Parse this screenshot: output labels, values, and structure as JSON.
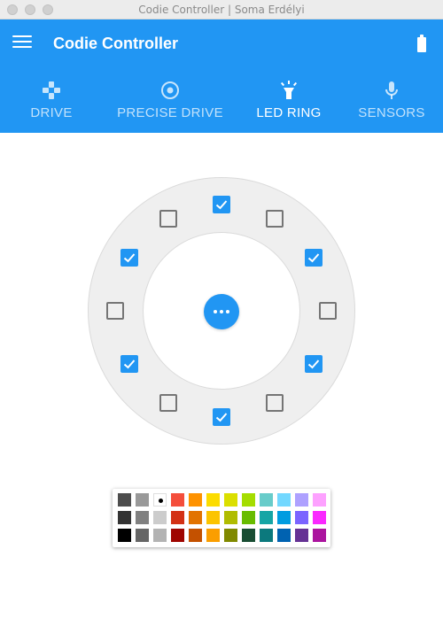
{
  "window": {
    "title": "Codie Controller | Soma Erdélyi"
  },
  "appbar": {
    "title": "Codie Controller",
    "accent_color": "#2196f3",
    "menu_icon": "menu-icon",
    "battery_icon": "battery-full-icon"
  },
  "tabs": [
    {
      "label": "DRIVE",
      "icon": "gamepad-icon",
      "active": false
    },
    {
      "label": "PRECISE DRIVE",
      "icon": "target-icon",
      "active": false
    },
    {
      "label": "LED RING",
      "icon": "light-icon",
      "active": true
    },
    {
      "label": "SENSORS",
      "icon": "microphone-icon",
      "active": false
    }
  ],
  "led_ring": {
    "leds": [
      {
        "position": "12 o'clock",
        "checked": true
      },
      {
        "position": "1 o'clock",
        "checked": false
      },
      {
        "position": "2 o'clock",
        "checked": true
      },
      {
        "position": "3 o'clock",
        "checked": false
      },
      {
        "position": "4 o'clock",
        "checked": true
      },
      {
        "position": "5 o'clock",
        "checked": false
      },
      {
        "position": "6 o'clock",
        "checked": true
      },
      {
        "position": "7 o'clock",
        "checked": false
      },
      {
        "position": "8 o'clock",
        "checked": true
      },
      {
        "position": "9 o'clock",
        "checked": false
      },
      {
        "position": "10 o'clock",
        "checked": true
      },
      {
        "position": "11 o'clock",
        "checked": false
      }
    ],
    "center_button_icon": "more-horizontal-icon"
  },
  "palette": {
    "selected": "#ffffff",
    "rows": [
      [
        "#4d4d4d",
        "#999999",
        "#ffffff",
        "#f44e3b",
        "#fe9200",
        "#fcdc00",
        "#dbdf00",
        "#a4dd00",
        "#68ccca",
        "#73d8ff",
        "#aea1ff",
        "#fda1ff"
      ],
      [
        "#333333",
        "#808080",
        "#cccccc",
        "#d33115",
        "#e27300",
        "#fcc400",
        "#b0bc00",
        "#68bc00",
        "#16a5a5",
        "#009ce0",
        "#7b64ff",
        "#fa28ff"
      ],
      [
        "#000000",
        "#666666",
        "#b3b3b3",
        "#9f0500",
        "#c45100",
        "#fb9e00",
        "#808900",
        "#194d33",
        "#0c797d",
        "#0062b1",
        "#653294",
        "#ab149e"
      ]
    ]
  }
}
